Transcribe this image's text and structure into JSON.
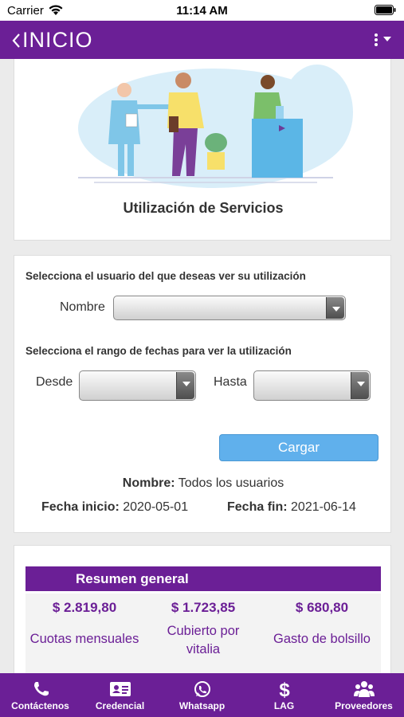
{
  "status_bar": {
    "carrier": "Carrier",
    "time": "11:14 AM"
  },
  "header": {
    "title": "INICIO"
  },
  "hero": {
    "title": "Utilización de Servicios"
  },
  "form": {
    "user_prompt": "Selecciona el usuario del que deseas ver su utilización",
    "name_label": "Nombre",
    "name_value": "",
    "date_prompt": "Selecciona el rango de fechas para ver la utilización",
    "from_label": "Desde",
    "from_value": "",
    "to_label": "Hasta",
    "to_value": "",
    "load_button": "Cargar"
  },
  "info": {
    "name_key": "Nombre:",
    "name_value": "Todos los usuarios",
    "start_key": "Fecha inicio:",
    "start_value": "2020-05-01",
    "end_key": "Fecha fin:",
    "end_value": "2021-06-14"
  },
  "summary": {
    "title": "Resumen general",
    "items": [
      {
        "value": "$ 2.819,80",
        "label": "Cuotas mensuales"
      },
      {
        "value": "$ 1.723,85",
        "label": "Cubierto por vitalia"
      },
      {
        "value": "$ 680,80",
        "label": "Gasto de bolsillo"
      }
    ]
  },
  "bottom_nav": [
    {
      "label": "Contáctenos",
      "icon": "phone-icon"
    },
    {
      "label": "Credencial",
      "icon": "id-card-icon"
    },
    {
      "label": "Whatsapp",
      "icon": "whatsapp-icon"
    },
    {
      "label": "LAG",
      "icon": "dollar-icon"
    },
    {
      "label": "Proveedores",
      "icon": "users-icon"
    }
  ],
  "colors": {
    "brand": "#6b1f96",
    "button": "#60b0ec",
    "background": "#ebebeb"
  }
}
